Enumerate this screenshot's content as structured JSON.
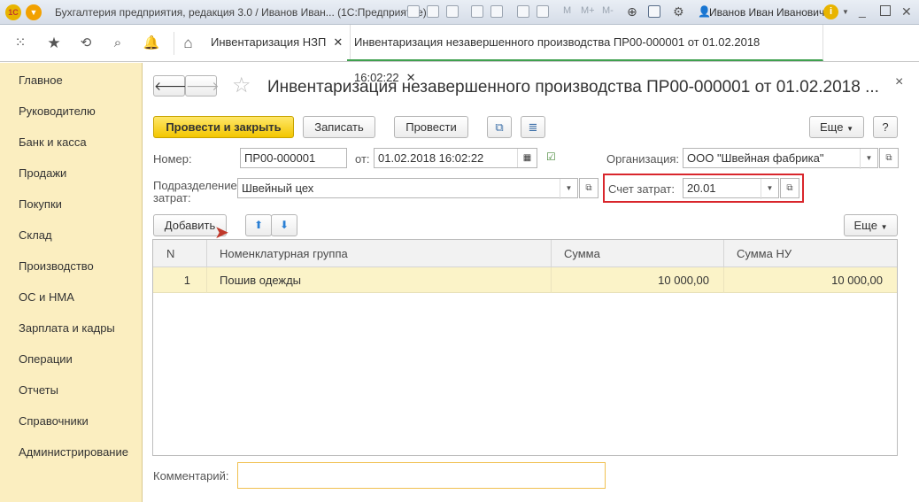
{
  "window": {
    "title": "Бухгалтерия предприятия, редакция 3.0 / Иванов Иван...  (1С:Предприятие)",
    "user": "Иванов Иван Иванович",
    "toolbar_letters": [
      "M",
      "M+",
      "M-"
    ]
  },
  "tabs": [
    {
      "label": "Инвентаризация НЗП",
      "close": "✕"
    },
    {
      "label": "Инвентаризация незавершенного производства ПР00-000001 от 01.02.2018 16:02:22",
      "close": "✕"
    }
  ],
  "sidebar": {
    "items": [
      "Главное",
      "Руководителю",
      "Банк и касса",
      "Продажи",
      "Покупки",
      "Склад",
      "Производство",
      "ОС и НМА",
      "Зарплата и кадры",
      "Операции",
      "Отчеты",
      "Справочники",
      "Администрирование"
    ]
  },
  "form": {
    "title": "Инвентаризация незавершенного производства ПР00-000001 от 01.02.2018 ...",
    "close": "×",
    "buttons": {
      "post_close": "Провести и закрыть",
      "save": "Записать",
      "post": "Провести",
      "more": "Еще",
      "help": "?",
      "add": "Добавить",
      "table_more": "Еще"
    },
    "number_label": "Номер:",
    "number_value": "ПР00-000001",
    "date_label": "от:",
    "date_value": "01.02.2018 16:02:22",
    "org_label": "Организация:",
    "org_value": "ООО \"Швейная фабрика\"",
    "dept_label_1": "Подразделение",
    "dept_label_2": "затрат:",
    "dept_value": "Швейный цех",
    "account_label": "Счет затрат:",
    "account_value": "20.01",
    "comment_label": "Комментарий:",
    "comment_value": "",
    "highlight_color": "#d9262c",
    "comment_border_color": "#f0c050"
  },
  "table": {
    "columns": [
      "N",
      "Номенклатурная группа",
      "Сумма",
      "Сумма НУ"
    ],
    "rows": [
      {
        "n": "1",
        "group": "Пошив одежды",
        "sum": "10 000,00",
        "sum_nu": "10 000,00"
      }
    ]
  }
}
